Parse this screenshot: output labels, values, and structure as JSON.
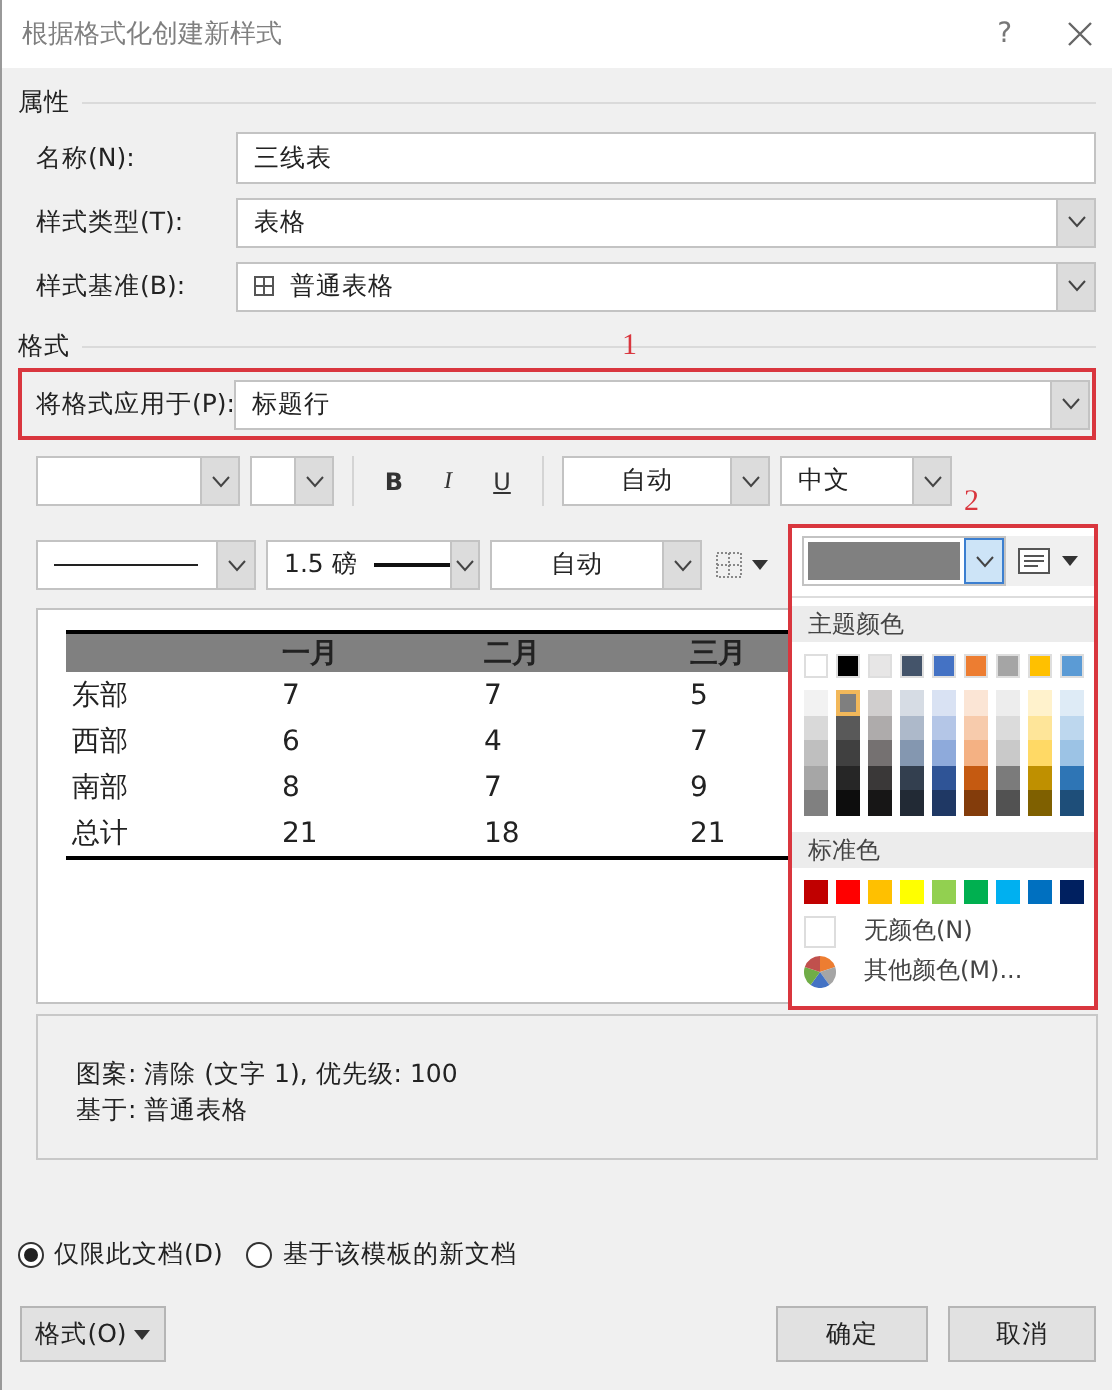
{
  "window": {
    "title": "根据格式化创建新样式",
    "help": "?"
  },
  "properties": {
    "heading": "属性",
    "fields": [
      {
        "label": "名称(N):",
        "kind": "text",
        "value": "三线表"
      },
      {
        "label": "样式类型(T):",
        "kind": "select",
        "value": "表格"
      },
      {
        "label": "样式基准(B):",
        "kind": "table-select",
        "value": "普通表格"
      }
    ]
  },
  "format": {
    "heading": "格式",
    "apply_to": {
      "label": "将格式应用于(P):",
      "value": "标题行"
    },
    "font_toolbar": {
      "format_buttons": [
        {
          "label": "B",
          "kind": "bold"
        },
        {
          "label": "I",
          "kind": "italic"
        },
        {
          "label": "U",
          "kind": "underline"
        }
      ],
      "font_color": "自动",
      "language": "中文"
    },
    "border_toolbar": {
      "weight": "1.5 磅",
      "border_color": "自动",
      "shading": {
        "color": "#808080"
      }
    }
  },
  "preview": {
    "header": [
      "一月",
      "二月",
      "三月"
    ],
    "rows": [
      {
        "label": "东部",
        "values": [
          "7",
          "7",
          "5"
        ]
      },
      {
        "label": "西部",
        "values": [
          "6",
          "4",
          "7"
        ]
      },
      {
        "label": "南部",
        "values": [
          "8",
          "7",
          "9"
        ]
      },
      {
        "label": "总计",
        "values": [
          "21",
          "18",
          "21"
        ]
      }
    ]
  },
  "color_menu": {
    "theme_heading": "主题颜色",
    "theme_colors": [
      {
        "color": "#ffffff",
        "selected": false,
        "shades": [
          {
            "color": "#f2f2f2",
            "selected": false
          },
          {
            "color": "#d9d9d9",
            "selected": false
          },
          {
            "color": "#bfbfbf",
            "selected": false
          },
          {
            "color": "#a6a6a6",
            "selected": false
          },
          {
            "color": "#808080",
            "selected": false
          }
        ]
      },
      {
        "color": "#000000",
        "selected": false,
        "shades": [
          {
            "color": "#7f7f7f",
            "selected": true
          },
          {
            "color": "#595959",
            "selected": false
          },
          {
            "color": "#404040",
            "selected": false
          },
          {
            "color": "#262626",
            "selected": false
          },
          {
            "color": "#0d0d0d",
            "selected": false
          }
        ]
      },
      {
        "color": "#e7e6e6",
        "selected": false,
        "shades": [
          {
            "color": "#d0cece",
            "selected": false
          },
          {
            "color": "#aeabab",
            "selected": false
          },
          {
            "color": "#757171",
            "selected": false
          },
          {
            "color": "#3a3838",
            "selected": false
          },
          {
            "color": "#171616",
            "selected": false
          }
        ]
      },
      {
        "color": "#44546a",
        "selected": false,
        "shades": [
          {
            "color": "#d6dce4",
            "selected": false
          },
          {
            "color": "#adb9ca",
            "selected": false
          },
          {
            "color": "#8497b0",
            "selected": false
          },
          {
            "color": "#333f4f",
            "selected": false
          },
          {
            "color": "#222a35",
            "selected": false
          }
        ]
      },
      {
        "color": "#4472c4",
        "selected": false,
        "shades": [
          {
            "color": "#d9e2f3",
            "selected": false
          },
          {
            "color": "#b4c6e7",
            "selected": false
          },
          {
            "color": "#8eaadb",
            "selected": false
          },
          {
            "color": "#2f5496",
            "selected": false
          },
          {
            "color": "#1f3864",
            "selected": false
          }
        ]
      },
      {
        "color": "#ed7d31",
        "selected": false,
        "shades": [
          {
            "color": "#fbe5d5",
            "selected": false
          },
          {
            "color": "#f7cbac",
            "selected": false
          },
          {
            "color": "#f4b183",
            "selected": false
          },
          {
            "color": "#c55a11",
            "selected": false
          },
          {
            "color": "#833c0b",
            "selected": false
          }
        ]
      },
      {
        "color": "#a5a5a5",
        "selected": false,
        "shades": [
          {
            "color": "#ededed",
            "selected": false
          },
          {
            "color": "#dbdbdb",
            "selected": false
          },
          {
            "color": "#c9c9c9",
            "selected": false
          },
          {
            "color": "#7b7b7b",
            "selected": false
          },
          {
            "color": "#525252",
            "selected": false
          }
        ]
      },
      {
        "color": "#ffc000",
        "selected": false,
        "shades": [
          {
            "color": "#fff2cc",
            "selected": false
          },
          {
            "color": "#fee599",
            "selected": false
          },
          {
            "color": "#ffd965",
            "selected": false
          },
          {
            "color": "#bf9000",
            "selected": false
          },
          {
            "color": "#7f6000",
            "selected": false
          }
        ]
      },
      {
        "color": "#5b9bd5",
        "selected": false,
        "shades": [
          {
            "color": "#deebf6",
            "selected": false
          },
          {
            "color": "#bdd7ee",
            "selected": false
          },
          {
            "color": "#9cc3e5",
            "selected": false
          },
          {
            "color": "#2e75b5",
            "selected": false
          },
          {
            "color": "#1e4e79",
            "selected": false
          }
        ]
      }
    ],
    "standard_heading": "标准色",
    "standard_colors": [
      {
        "color": "#c00000",
        "selected": false
      },
      {
        "color": "#ff0000",
        "selected": false
      },
      {
        "color": "#ffc000",
        "selected": false
      },
      {
        "color": "#ffff00",
        "selected": false
      },
      {
        "color": "#92d050",
        "selected": false
      },
      {
        "color": "#00b050",
        "selected": false
      },
      {
        "color": "#00b0f0",
        "selected": false
      },
      {
        "color": "#0070c0",
        "selected": false
      },
      {
        "color": "#002060",
        "selected": false
      }
    ],
    "no_color": "无颜色(N)",
    "more_colors": "其他颜色(M)..."
  },
  "description": [
    "图案: 清除 (文字 1), 优先级: 100",
    "基于: 普通表格"
  ],
  "scope": [
    {
      "label": "仅限此文档(D)",
      "selected": true
    },
    {
      "label": "基于该模板的新文档",
      "selected": false
    }
  ],
  "buttons": {
    "format": "格式(O)",
    "ok": "确定",
    "cancel": "取消"
  },
  "annotations": [
    {
      "label": "1"
    },
    {
      "label": "2"
    }
  ]
}
